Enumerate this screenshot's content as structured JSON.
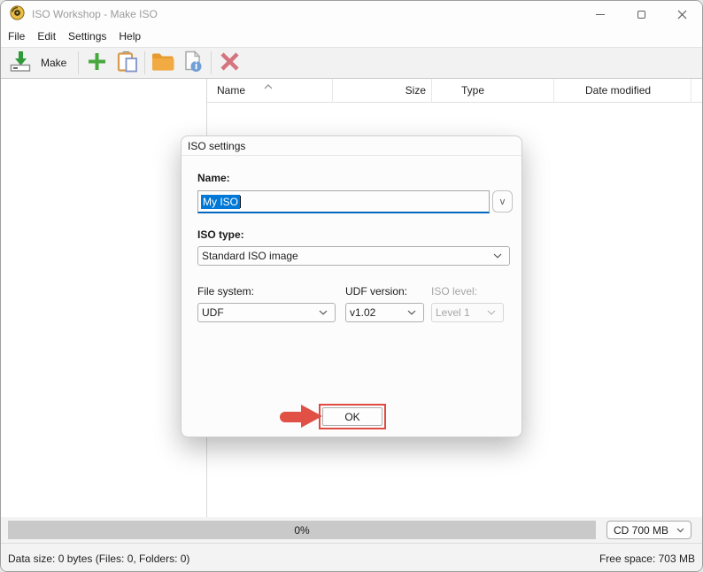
{
  "window": {
    "title": "ISO Workshop - Make ISO"
  },
  "menu": {
    "items": [
      "File",
      "Edit",
      "Settings",
      "Help"
    ]
  },
  "toolbar": {
    "make_label": "Make",
    "icons": [
      "make-icon",
      "add-files-icon",
      "paste-icon",
      "open-folder-icon",
      "properties-icon",
      "delete-icon"
    ]
  },
  "file_list": {
    "columns": [
      "Name",
      "Size",
      "Type",
      "Date modified"
    ],
    "sort_column": "Name",
    "sort_direction": "ascending"
  },
  "dialog": {
    "title": "ISO settings",
    "name_label": "Name:",
    "name_value": "My ISO",
    "name_history_button_label": "v",
    "iso_type_label": "ISO type:",
    "iso_type_value": "Standard ISO image",
    "file_system_label": "File system:",
    "file_system_value": "UDF",
    "udf_version_label": "UDF version:",
    "udf_version_value": "v1.02",
    "iso_level_label": "ISO level:",
    "iso_level_value": "Level 1",
    "ok_label": "OK"
  },
  "progress": {
    "value_label": "0%",
    "disc_capacity": "CD 700 MB"
  },
  "status_bar": {
    "data_size": "Data size: 0 bytes (Files: 0, Folders: 0)",
    "free_space": "Free space: 703 MB"
  },
  "colors": {
    "selection_blue": "#0078d7",
    "focus_border_blue": "#0267c0",
    "annotation_red": "#e04a42",
    "toolbar_green": "#3fa63f",
    "folder_orange": "#efa93d",
    "delete_pink": "#d5737e",
    "progress_track_gray": "#c9c9c9",
    "title_text_gray": "#9c9c9c"
  }
}
